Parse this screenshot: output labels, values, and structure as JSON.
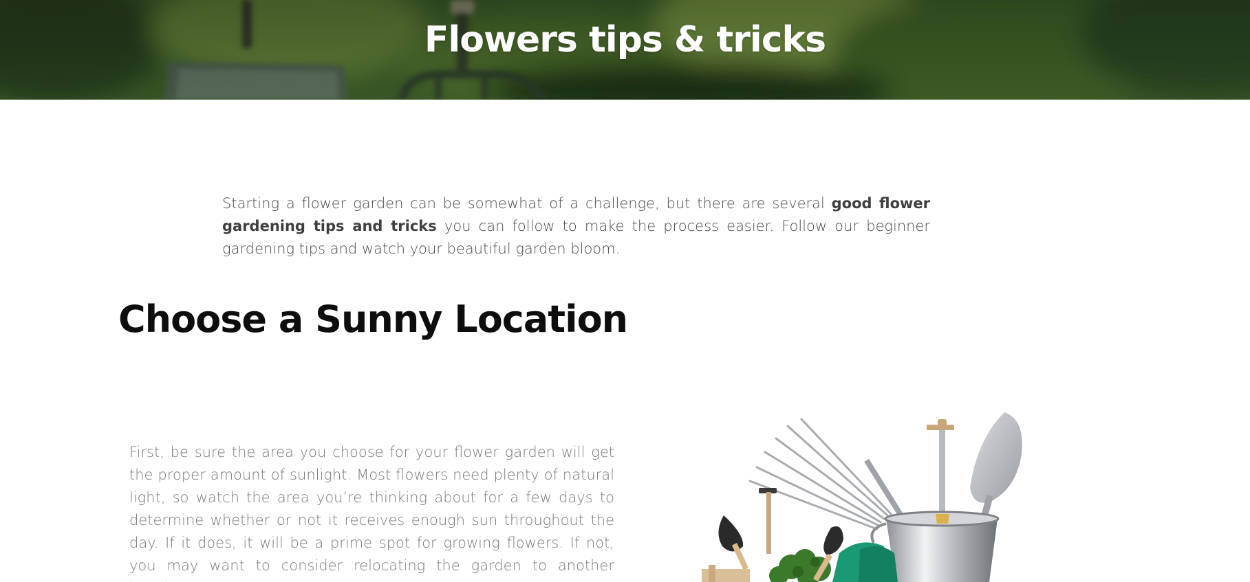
{
  "hero": {
    "title": "Flowers tips & tricks"
  },
  "intro": {
    "text_before": "Starting a flower garden can be somewhat of a challenge, but there are several ",
    "bold_text": "good flower gardening tips and tricks",
    "text_after": " you can follow to make the process easier. Follow our beginner gardening tips and watch your beautiful garden bloom."
  },
  "section": {
    "heading": "Choose a Sunny Location",
    "body": "First, be sure the area you choose for your flower garden will get the proper amount of sunlight. Most flowers need plenty of natural light, so watch the area you’re thinking about for a few days to determine whether or not it receives enough sun throughout the day. If it does, it will be a prime spot for growing flowers. If not, you may want to consider relocating the garden to another location"
  },
  "icons": {
    "hero_background": "garden-tools-photo",
    "tools_image": "garden-tools-bucket-icon"
  },
  "colors": {
    "hero_overlay": "#2f4a22",
    "heading": "#0d0d0d",
    "intro_text": "#4b4b4b",
    "body_text": "#7a7a7a",
    "accent_green": "#1a9a72"
  }
}
